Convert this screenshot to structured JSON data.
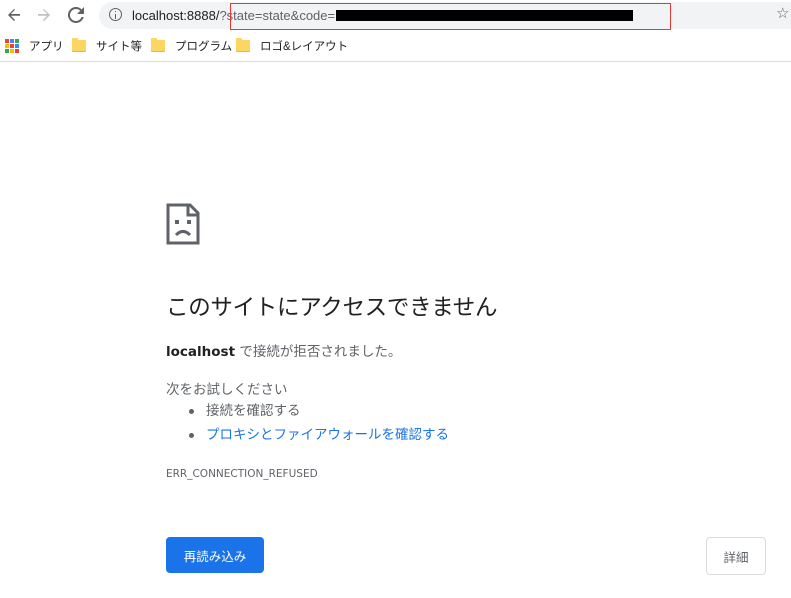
{
  "toolbar": {
    "url_host": "localhost:8888/",
    "url_rest": "?state=state&code="
  },
  "bookmarks": [
    {
      "label": "アプリ",
      "icon": "apps-grid-icon"
    },
    {
      "label": "サイト等",
      "icon": "folder-icon"
    },
    {
      "label": "プログラム",
      "icon": "folder-icon"
    },
    {
      "label": "ロゴ&レイアウト",
      "icon": "folder-icon"
    }
  ],
  "error": {
    "heading": "このサイトにアクセスできません",
    "host": "localhost",
    "desc_rest": " で接続が拒否されました。",
    "suggest_title": "次をお試しください",
    "suggestions": [
      "接続を確認する",
      "プロキシとファイアウォールを確認する"
    ],
    "code": "ERR_CONNECTION_REFUSED",
    "reload_label": "再読み込み",
    "details_label": "詳細"
  },
  "colors": {
    "accent": "#1a73e8",
    "highlight_border": "#e53935",
    "folder": "#fcd661"
  }
}
